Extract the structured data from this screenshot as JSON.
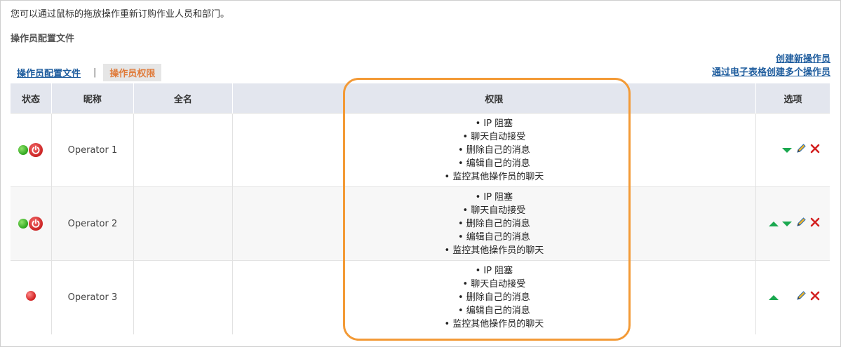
{
  "intro_text": "您可以通过鼠标的拖放操作重新订购作业人员和部门。",
  "section_title": "操作员配置文件",
  "tabs": [
    {
      "label": "操作员配置文件"
    },
    {
      "label": "操作员权限"
    }
  ],
  "tab_separator": "|",
  "links": {
    "create_operator": "创建新操作员",
    "create_from_spreadsheet": "通过电子表格创建多个操作员"
  },
  "table": {
    "headers": {
      "status": "状态",
      "nickname": "昵称",
      "fullname": "全名",
      "permissions": "权限",
      "options": "选项"
    },
    "rows": [
      {
        "nickname": "Operator 1",
        "fullname": "",
        "status": "online",
        "permissions": [
          "IP 阻塞",
          "聊天自动接受",
          "删除自己的消息",
          "编辑自己的消息",
          "监控其他操作员的聊天"
        ]
      },
      {
        "nickname": "Operator 2",
        "fullname": "",
        "status": "online",
        "permissions": [
          "IP 阻塞",
          "聊天自动接受",
          "删除自己的消息",
          "编辑自己的消息",
          "监控其他操作员的聊天"
        ]
      },
      {
        "nickname": "Operator 3",
        "fullname": "",
        "status": "offline",
        "permissions": [
          "IP 阻塞",
          "聊天自动接受",
          "删除自己的消息",
          "编辑自己的消息",
          "监控其他操作员的聊天"
        ]
      }
    ]
  },
  "colors": {
    "link": "#1f5d9e",
    "active_tab": "#e07b3a",
    "header_bg": "#e3e6ee",
    "highlight": "#f39a36",
    "arrow": "#1aa84f"
  }
}
